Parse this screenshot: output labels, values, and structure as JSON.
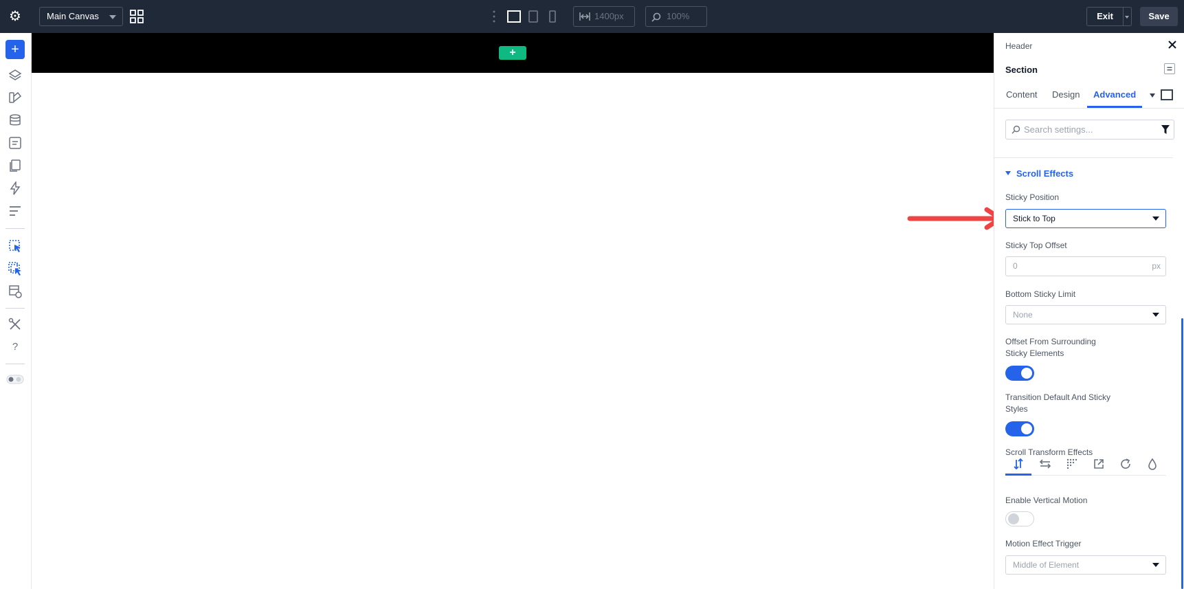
{
  "topbar": {
    "canvas_name": "Main Canvas",
    "width_value": "1400px",
    "zoom_value": "100%",
    "exit_label": "Exit",
    "save_label": "Save"
  },
  "panel": {
    "breadcrumb": "Header",
    "title": "Section",
    "tabs": [
      "Content",
      "Design",
      "Advanced"
    ],
    "active_tab": "Advanced",
    "search_placeholder": "Search settings...",
    "section_title": "Scroll Effects",
    "sticky_position": {
      "label": "Sticky Position",
      "value": "Stick to Top"
    },
    "sticky_top_offset": {
      "label": "Sticky Top Offset",
      "value": "0",
      "unit": "px"
    },
    "bottom_sticky_limit": {
      "label": "Bottom Sticky Limit",
      "value": "None"
    },
    "offset_surrounding": {
      "label_line1": "Offset From Surrounding",
      "label_line2": "Sticky Elements",
      "enabled": true
    },
    "transition_default": {
      "label_line1": "Transition Default And Sticky",
      "label_line2": "Styles",
      "enabled": true
    },
    "scroll_transform": {
      "label": "Scroll Transform Effects",
      "icons": [
        "vertical-motion-icon",
        "horizontal-motion-icon",
        "fade-icon",
        "scale-icon",
        "rotate-icon",
        "blur-icon"
      ]
    },
    "enable_vertical_motion": {
      "label": "Enable Vertical Motion",
      "enabled": false
    },
    "motion_effect_trigger": {
      "label": "Motion Effect Trigger",
      "value": "Middle of Element"
    }
  },
  "colors": {
    "accent": "#2563eb",
    "topbar": "#1f2937",
    "add_section": "#10b981",
    "arrow": "#ef4444"
  }
}
